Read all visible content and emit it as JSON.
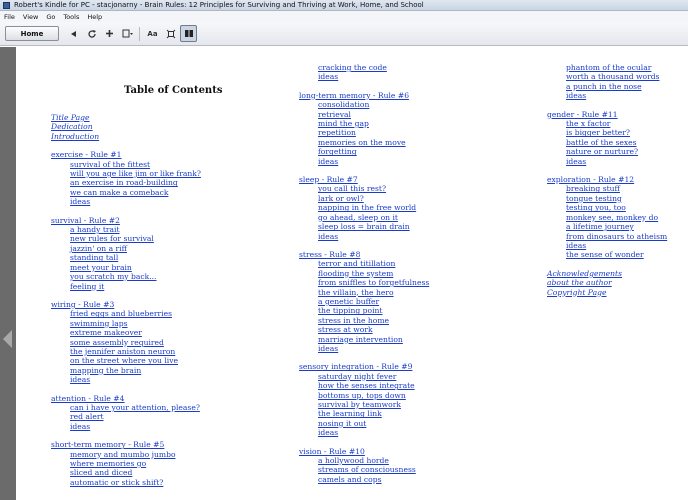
{
  "window": {
    "title": "Robert's Kindle for PC - stacjonarny - Brain Rules: 12 Principles for Surviving and Thriving at Work, Home, and School"
  },
  "menu": [
    "File",
    "View",
    "Go",
    "Tools",
    "Help"
  ],
  "toolbar": {
    "home_label": "Home",
    "font_label": "Aa"
  },
  "toc": {
    "title": "Table of Contents",
    "col1_front": [
      "Title Page",
      "Dedication",
      "Introduction"
    ],
    "col1": [
      {
        "head": "exercise - Rule #1",
        "items": [
          "survival of the fittest",
          "will you age like jim or like frank?",
          "an exercise in road-building",
          "we can make a comeback",
          "ideas"
        ]
      },
      {
        "head": "survival - Rule #2",
        "items": [
          "a handy trait",
          "new rules for survival",
          "jazzin' on a riff",
          "standing tall",
          "meet your brain",
          "you scratch my back...",
          "feeling it"
        ]
      },
      {
        "head": "wiring - Rule #3",
        "items": [
          "fried eggs and blueberries",
          "swimming laps",
          "extreme makeover",
          "some assembly required",
          "the jennifer aniston neuron",
          "on the street where you live",
          "mapping the brain",
          "ideas"
        ]
      },
      {
        "head": "attention - Rule #4",
        "items": [
          "can i have your attention, please?",
          "red alert",
          "ideas"
        ]
      },
      {
        "head": "short-term memory - Rule #5",
        "items": [
          "memory and mumbo jumbo",
          "where memories go",
          "sliced and diced",
          "automatic or stick shift?"
        ]
      }
    ],
    "col2_top": [
      "cracking the code",
      "ideas"
    ],
    "col2": [
      {
        "head": "long-term memory - Rule #6",
        "items": [
          "consolidation",
          "retrieval",
          "mind the gap",
          "repetition",
          "memories on the move",
          "forgetting",
          "ideas"
        ]
      },
      {
        "head": "sleep - Rule #7",
        "items": [
          "you call this rest?",
          "lark or owl?",
          "napping in the free world",
          "go ahead, sleep on it",
          "sleep loss = brain drain",
          "ideas"
        ]
      },
      {
        "head": "stress - Rule #8",
        "items": [
          "terror and titillation",
          "flooding the system",
          "from sniffles to forgetfulness",
          "the villain, the hero",
          "a genetic buffer",
          "the tipping point",
          "stress in the home",
          "stress at work",
          "marriage intervention",
          "ideas"
        ]
      },
      {
        "head": "sensory integration - Rule #9",
        "items": [
          "saturday night fever",
          "how the senses integrate",
          "bottoms up, tops down",
          "survival by teamwork",
          "the learning link",
          "nosing it out",
          "ideas"
        ]
      },
      {
        "head": "vision - Rule #10",
        "items": [
          "a hollywood horde",
          "streams of consciousness",
          "camels and cops"
        ]
      }
    ],
    "col3_top": [
      "phantom of the ocular",
      "worth a thousand words",
      "a punch in the nose",
      "ideas"
    ],
    "col3": [
      {
        "head": "gender - Rule #11",
        "items": [
          "the x factor",
          "is bigger better?",
          "battle of the sexes",
          "nature or nurture?",
          "ideas"
        ]
      },
      {
        "head": "exploration - Rule #12",
        "items": [
          "breaking stuff",
          "tongue testing",
          "testing you, too",
          "monkey see, monkey do",
          "a lifetime journey",
          "from dinosaurs to atheism",
          "ideas",
          "the sense of wonder"
        ]
      }
    ],
    "col3_back": [
      "Acknowledgements",
      "about the author",
      "Copyright Page"
    ]
  }
}
